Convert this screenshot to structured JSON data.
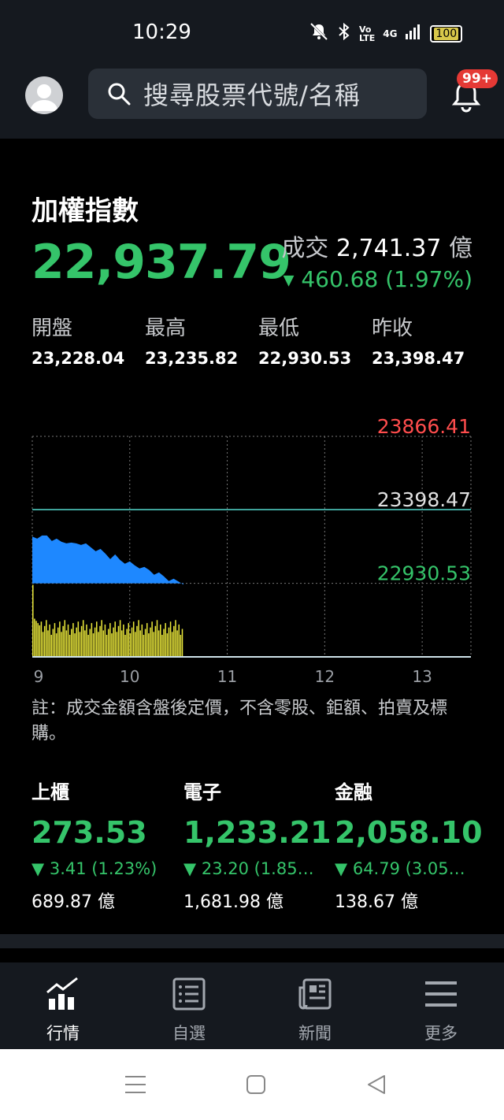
{
  "status_bar": {
    "time": "10:29",
    "network": "4G",
    "battery": "100"
  },
  "header": {
    "search_placeholder": "搜尋股票代號/名稱",
    "notification_badge": "99+"
  },
  "index": {
    "name": "加權指數",
    "value": "22,937.79",
    "volume_label": "成交",
    "volume_value": "2,741.37",
    "volume_unit": "億",
    "change": "460.68 (1.97%)",
    "stats": [
      {
        "label": "開盤",
        "value": "23,228.04"
      },
      {
        "label": "最高",
        "value": "23,235.82"
      },
      {
        "label": "最低",
        "value": "22,930.53"
      },
      {
        "label": "昨收",
        "value": "23,398.47"
      }
    ]
  },
  "chart_data": {
    "type": "area",
    "price_labels": {
      "upper": "23866.41",
      "reference": "23398.47",
      "lower": "22930.53"
    },
    "y_range": [
      22930.53,
      23866.41
    ],
    "reference_line": 23398.47,
    "x_ticks": [
      "9",
      "10",
      "11",
      "12",
      "13"
    ],
    "x_range_hours": [
      9,
      13.5
    ],
    "price_series": {
      "x_hours": [
        9.0,
        9.05,
        9.1,
        9.15,
        9.2,
        9.25,
        9.3,
        9.35,
        9.4,
        9.45,
        9.5,
        9.55,
        9.6,
        9.65,
        9.7,
        9.75,
        9.8,
        9.85,
        9.9,
        9.95,
        10.0,
        10.05,
        10.1,
        10.15,
        10.2,
        10.25,
        10.3,
        10.35,
        10.4,
        10.45,
        10.5,
        10.55
      ],
      "values": [
        23228,
        23230,
        23225,
        23235,
        23215,
        23205,
        23195,
        23200,
        23180,
        23185,
        23190,
        23175,
        23160,
        23150,
        23140,
        23120,
        23100,
        23105,
        23080,
        23070,
        23060,
        23045,
        23040,
        23025,
        23015,
        23000,
        22990,
        22975,
        22960,
        22950,
        22942,
        22938
      ]
    },
    "volume_series": {
      "bar_count": 90,
      "first_bar_relative_height": 0.98,
      "typical_relative_height": 0.4
    },
    "grid": true,
    "colors": {
      "price_area": "#1e88ff",
      "volume": "#e8e63a",
      "upper_label": "#ff4d4d",
      "reference_label": "#e0e0e0",
      "lower_label": "#35c46a",
      "reference_line": "#3fa39a"
    }
  },
  "note": "註：成交金額含盤後定價，不含零股、鉅額、拍賣及標購。",
  "sub_indexes": [
    {
      "name": "上櫃",
      "value": "273.53",
      "change": "3.41 (1.23%)",
      "amount": "689.87 億"
    },
    {
      "name": "電子",
      "value": "1,233.21",
      "change": "23.20 (1.85…",
      "amount": "1,681.98 億"
    },
    {
      "name": "金融",
      "value": "2,058.10",
      "change": "64.79 (3.05…",
      "amount": "138.67 億"
    }
  ],
  "bottom_nav": [
    {
      "label": "行情",
      "icon": "market-chart-icon",
      "active": true
    },
    {
      "label": "自選",
      "icon": "watchlist-icon",
      "active": false
    },
    {
      "label": "新聞",
      "icon": "news-icon",
      "active": false
    },
    {
      "label": "更多",
      "icon": "menu-icon",
      "active": false
    }
  ],
  "colors": {
    "up_down_green": "#35c46a",
    "background": "#000000",
    "bar_background": "#15191f"
  }
}
